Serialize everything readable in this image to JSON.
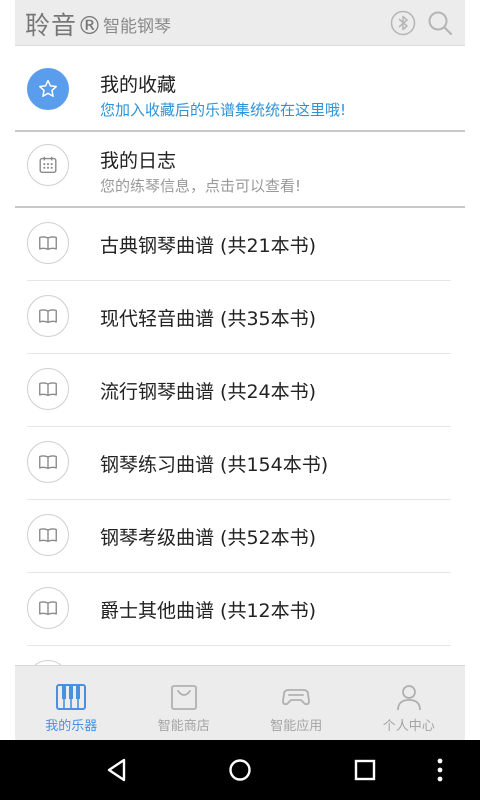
{
  "header": {
    "brand": "聆音®",
    "subtitle": "智能钢琴",
    "bluetooth_icon": "bluetooth-icon",
    "search_icon": "search-icon"
  },
  "colors": {
    "accent": "#4a90e2",
    "fav_bg": "#5b9ded",
    "link_text": "#2e93d6",
    "muted_text": "#999999"
  },
  "special_items": [
    {
      "title": "我的收藏",
      "desc": "您加入收藏后的乐谱集统统在这里哦!",
      "icon": "star-icon"
    },
    {
      "title": "我的日志",
      "desc": "您的练琴信息，点击可以查看!",
      "icon": "calendar-icon"
    }
  ],
  "books": [
    {
      "label": "古典钢琴曲谱 (共21本书)"
    },
    {
      "label": "现代轻音曲谱 (共35本书)"
    },
    {
      "label": "流行钢琴曲谱 (共24本书)"
    },
    {
      "label": "钢琴练习曲谱 (共154本书)"
    },
    {
      "label": "钢琴考级曲谱 (共52本书)"
    },
    {
      "label": "爵士其他曲谱 (共12本书)"
    }
  ],
  "tabs": [
    {
      "label": "我的乐器",
      "icon": "piano-icon",
      "active": true
    },
    {
      "label": "智能商店",
      "icon": "shopping-bag-icon",
      "active": false
    },
    {
      "label": "智能应用",
      "icon": "gamepad-icon",
      "active": false
    },
    {
      "label": "个人中心",
      "icon": "person-icon",
      "active": false
    }
  ],
  "navbar": {
    "back_icon": "back-icon",
    "home_icon": "home-icon",
    "recents_icon": "recents-icon",
    "menu_icon": "more-vert-icon"
  }
}
